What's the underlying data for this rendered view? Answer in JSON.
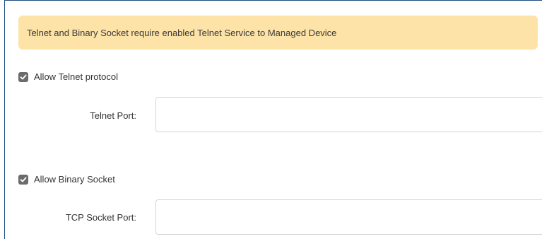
{
  "alert": {
    "text": "Telnet and Binary Socket require enabled Telnet Service to Managed Device",
    "color": "#fde3a7"
  },
  "telnet": {
    "checkbox_label": "Allow Telnet protocol",
    "checked": true,
    "port_label": "Telnet Port:",
    "port_value": ""
  },
  "binary_socket": {
    "checkbox_label": "Allow Binary Socket",
    "checked": true,
    "port_label": "TCP Socket Port:",
    "port_value": ""
  },
  "icons": {
    "checkbox": "checkmark-icon"
  },
  "colors": {
    "accent_border": "#1e4f80",
    "checkbox_fill": "#6b6b6b"
  }
}
